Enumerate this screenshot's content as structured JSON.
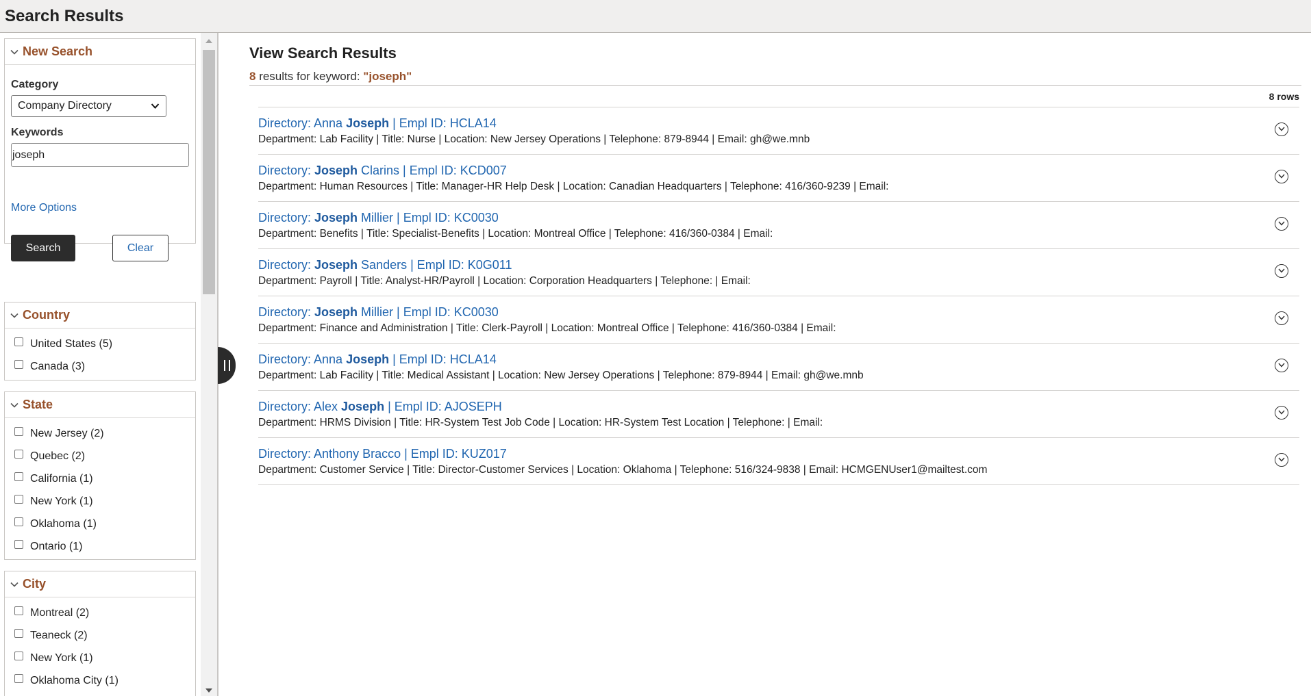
{
  "header": {
    "title": "Search Results"
  },
  "search_panel": {
    "title": "New Search",
    "category_label": "Category",
    "category_value": "Company Directory",
    "keywords_label": "Keywords",
    "keywords_value": "joseph",
    "more_options": "More Options",
    "search_button": "Search",
    "clear_button": "Clear"
  },
  "facets": {
    "country": {
      "title": "Country",
      "items": [
        "United States (5)",
        "Canada (3)"
      ]
    },
    "state": {
      "title": "State",
      "items": [
        "New Jersey (2)",
        "Quebec (2)",
        "California (1)",
        "New York (1)",
        "Oklahoma (1)",
        "Ontario (1)"
      ]
    },
    "city": {
      "title": "City",
      "items": [
        "Montreal (2)",
        "Teaneck (2)",
        "New York (1)",
        "Oklahoma City (1)"
      ]
    }
  },
  "main": {
    "title": "View Search Results",
    "result_count": "8",
    "results_for_text": " results for keyword: ",
    "keyword_quoted": "\"joseph\"",
    "rows_label": "8 rows"
  },
  "results": [
    {
      "prefix": "Directory: Anna ",
      "highlight": "Joseph",
      "suffix": " | Empl ID: HCLA14",
      "desc": "Department: Lab Facility | Title: Nurse | Location: New Jersey Operations | Telephone: 879-8944 | Email: gh@we.mnb"
    },
    {
      "prefix": "Directory: ",
      "highlight": "Joseph",
      "suffix": " Clarins | Empl ID: KCD007",
      "desc": "Department: Human Resources | Title: Manager-HR Help Desk | Location: Canadian Headquarters | Telephone: 416/360-9239 | Email:"
    },
    {
      "prefix": "Directory: ",
      "highlight": "Joseph",
      "suffix": " Millier | Empl ID: KC0030",
      "desc": "Department: Benefits | Title: Specialist-Benefits | Location: Montreal Office | Telephone: 416/360-0384 | Email:"
    },
    {
      "prefix": "Directory: ",
      "highlight": "Joseph",
      "suffix": " Sanders | Empl ID: K0G011",
      "desc": "Department: Payroll | Title: Analyst-HR/Payroll | Location: Corporation Headquarters | Telephone: | Email:"
    },
    {
      "prefix": "Directory: ",
      "highlight": "Joseph",
      "suffix": " Millier | Empl ID: KC0030",
      "desc": "Department: Finance and Administration | Title: Clerk-Payroll | Location: Montreal Office | Telephone: 416/360-0384 | Email:"
    },
    {
      "prefix": "Directory: Anna ",
      "highlight": "Joseph",
      "suffix": " | Empl ID: HCLA14",
      "desc": "Department: Lab Facility | Title: Medical Assistant | Location: New Jersey Operations | Telephone: 879-8944 | Email: gh@we.mnb"
    },
    {
      "prefix": "Directory: Alex ",
      "highlight": "Joseph",
      "suffix": " | Empl ID: AJOSEPH",
      "desc": "Department: HRMS Division | Title: HR-System Test Job Code | Location: HR-System Test Location | Telephone: | Email:"
    },
    {
      "prefix": "Directory: Anthony Bracco | Empl ID: KUZ017",
      "highlight": "",
      "suffix": "",
      "desc": "Department: Customer Service | Title: Director-Customer Services | Location: Oklahoma | Telephone: 516/324-9838 | Email: HCMGENUser1@mailtest.com"
    }
  ],
  "colors": {
    "accent_brown": "#97512b",
    "link_blue": "#2166b0",
    "dark_button": "#2c2c2c"
  },
  "icons": {
    "panel_toggle": "chevron-down-icon",
    "result_expand": "circle-chevron-down-icon",
    "sidebar_collapse": "pause-bars-icon"
  }
}
